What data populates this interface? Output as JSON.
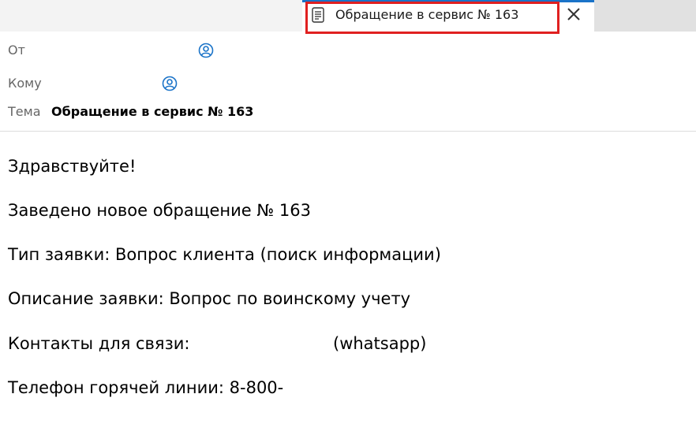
{
  "tab": {
    "title": "Обращение в сервис № 163",
    "icon": "document-icon",
    "close_icon": "close-icon",
    "accent_color": "#1a73c8",
    "highlight_color": "#e02020"
  },
  "header": {
    "from_label": "От",
    "from_value": "",
    "to_label": "Кому",
    "to_value": "",
    "subject_label": "Тема",
    "subject_value": "Обращение в сервис № 163",
    "contact_icon": "contact-card-icon"
  },
  "body": {
    "greeting": "Здравствуйте!",
    "new_ticket": "Заведено новое обращение № 163",
    "ticket_type": "Тип заявки: Вопрос клиента (поиск информации)",
    "description": "Описание заявки: Вопрос по воинскому учету",
    "contacts_label": "Контакты для связи:",
    "contacts_suffix": "(whatsapp)",
    "hotline": "Телефон горячей линии: 8-800-"
  }
}
